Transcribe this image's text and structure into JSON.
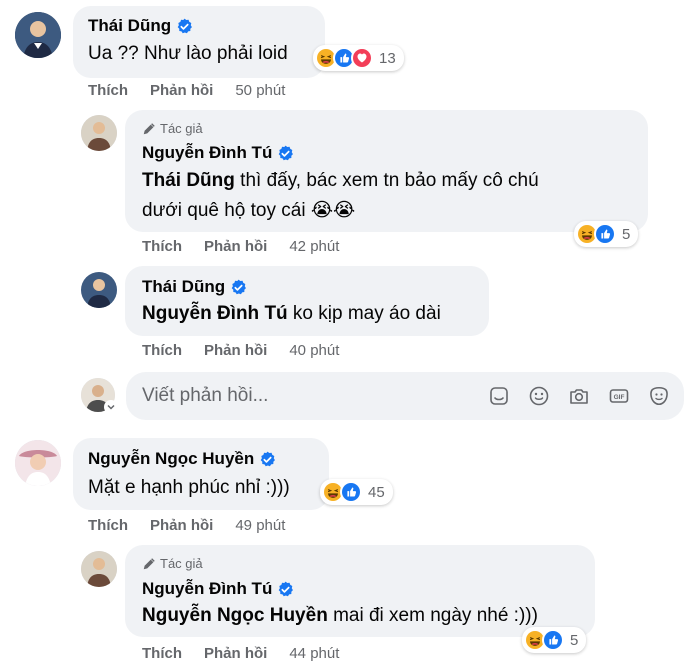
{
  "comments": [
    {
      "author": "Thái Dũng",
      "text": "Ua ?? Như lào phải loid",
      "reaction_count": "13",
      "actions": {
        "like": "Thích",
        "reply": "Phản hồi",
        "time": "50 phút"
      }
    },
    {
      "author_tag": "Tác giả",
      "author": "Nguyễn Đình Tú",
      "mention": "Thái Dũng",
      "text_line1": " thì đấy, bác xem tn bảo mấy cô chú",
      "text_line2": "dưới quê hộ toy cái 😭😭",
      "reaction_count": "5",
      "actions": {
        "like": "Thích",
        "reply": "Phản hồi",
        "time": "42 phút"
      }
    },
    {
      "author": "Thái Dũng",
      "mention": "Nguyễn Đình Tú",
      "text": " ko kịp may áo dài",
      "actions": {
        "like": "Thích",
        "reply": "Phản hồi",
        "time": "40 phút"
      }
    },
    {
      "author": "Nguyễn Ngọc Huyền",
      "text": "Mặt e hạnh phúc nhỉ :)))",
      "reaction_count": "45",
      "actions": {
        "like": "Thích",
        "reply": "Phản hồi",
        "time": "49 phút"
      }
    },
    {
      "author_tag": "Tác giả",
      "author": "Nguyễn Đình Tú",
      "mention": "Nguyễn Ngọc Huyền",
      "text": " mai đi xem ngày nhé :)))",
      "reaction_count": "5",
      "actions": {
        "like": "Thích",
        "reply": "Phản hồi",
        "time": "44 phút"
      }
    }
  ],
  "reply_box": {
    "placeholder": "Viết phản hồi..."
  },
  "icons": {
    "verified": "verified-badge-icon",
    "pen": "pen-icon",
    "haha": "haha-reaction-icon",
    "like": "like-reaction-icon",
    "love": "love-reaction-icon",
    "sticker": "sticker-icon",
    "emoji": "emoji-icon",
    "camera": "camera-icon",
    "gif": "gif-icon",
    "avatar_sticker": "avatar-sticker-icon"
  },
  "colors": {
    "accent": "#1877f2",
    "bubble": "#f0f2f5",
    "secondary_text": "#65676b",
    "haha": "#f7b125",
    "love": "#f33e58"
  }
}
